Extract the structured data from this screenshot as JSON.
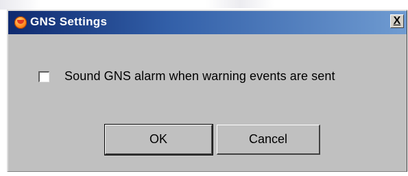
{
  "window": {
    "title": "GNS Settings",
    "close_label": "X",
    "app_icon": "gns-app-icon"
  },
  "settings": {
    "sound_alarm_label": "Sound GNS alarm when warning events are sent",
    "sound_alarm_checked": false
  },
  "buttons": {
    "ok_label": "OK",
    "cancel_label": "Cancel"
  },
  "colors": {
    "titlebar_start": "#0f2a6f",
    "titlebar_end": "#6f9bd1",
    "dialog_face": "#c0c0c0"
  }
}
